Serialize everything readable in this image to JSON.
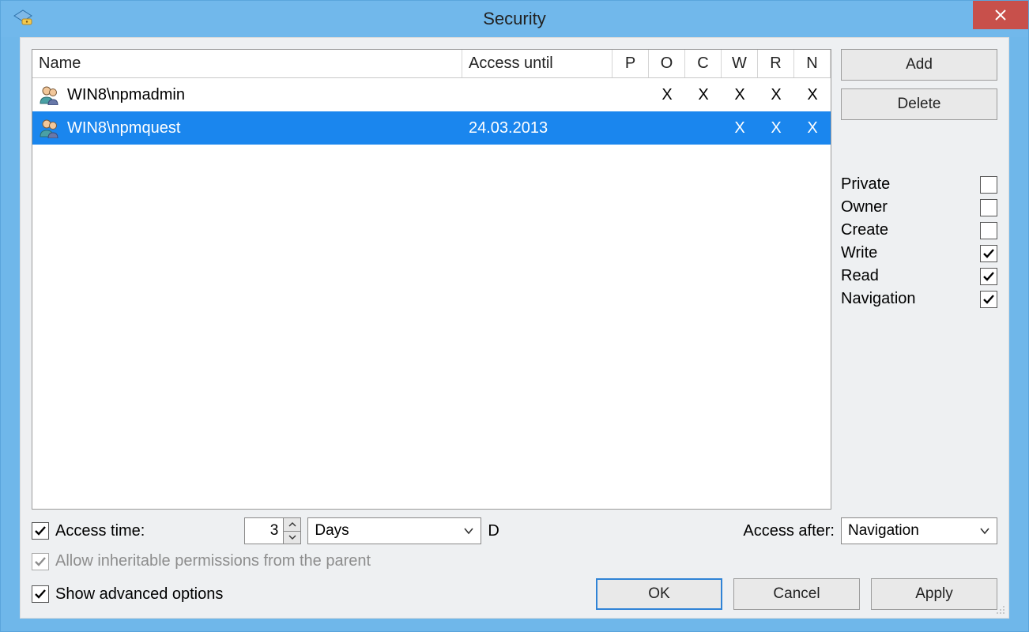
{
  "title": "Security",
  "close_icon": "close-icon",
  "grid": {
    "headers": {
      "name": "Name",
      "access_until": "Access until",
      "perms": [
        "P",
        "O",
        "C",
        "W",
        "R",
        "N"
      ]
    },
    "rows": [
      {
        "name": "WIN8\\npmadmin",
        "access_until": "",
        "perms": [
          "",
          "X",
          "X",
          "X",
          "X",
          "X"
        ],
        "selected": false
      },
      {
        "name": "WIN8\\npmquest",
        "access_until": "24.03.2013",
        "perms": [
          "",
          "",
          "",
          "X",
          "X",
          "X"
        ],
        "selected": true
      }
    ]
  },
  "side": {
    "add": "Add",
    "delete": "Delete",
    "perms": [
      {
        "label": "Private",
        "checked": false
      },
      {
        "label": "Owner",
        "checked": false
      },
      {
        "label": "Create",
        "checked": false
      },
      {
        "label": "Write",
        "checked": true
      },
      {
        "label": "Read",
        "checked": true
      },
      {
        "label": "Navigation",
        "checked": true
      }
    ]
  },
  "options": {
    "access_time_label": "Access time:",
    "access_time_checked": true,
    "access_time_value": "3",
    "access_time_unit": "Days",
    "access_time_suffix": "D",
    "access_after_label": "Access after:",
    "access_after_value": "Navigation",
    "inherit_label": "Allow inheritable permissions from the parent",
    "inherit_checked": true,
    "inherit_disabled": true,
    "show_advanced_label": "Show advanced options",
    "show_advanced_checked": true
  },
  "buttons": {
    "ok": "OK",
    "cancel": "Cancel",
    "apply": "Apply"
  }
}
